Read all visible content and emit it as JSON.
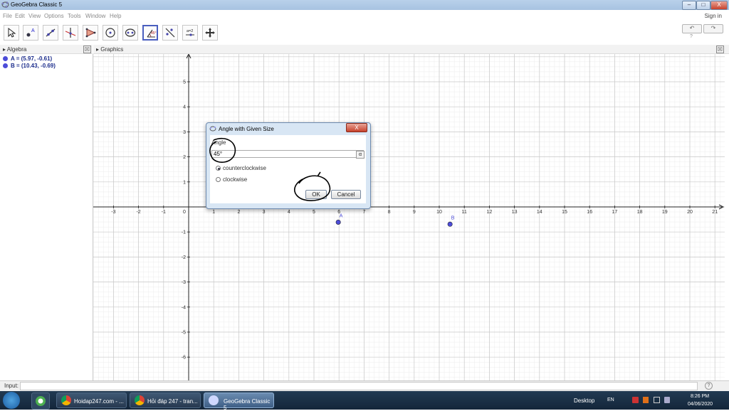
{
  "window": {
    "title": "GeoGebra Classic 5"
  },
  "menu": {
    "items": [
      "File",
      "Edit",
      "View",
      "Options",
      "Tools",
      "Window",
      "Help"
    ],
    "signin": "Sign in"
  },
  "window_buttons": {
    "minimize": "–",
    "maximize": "□",
    "close": "X"
  },
  "toolbar": {
    "undo": "↶",
    "redo": "↷",
    "help": "?"
  },
  "panels": {
    "algebra_title": "Algebra",
    "graphics_title": "Graphics",
    "close_glyph": "☒"
  },
  "algebra": {
    "items": [
      {
        "text": "A = (5.97, -0.61)"
      },
      {
        "text": "B = (10.43, -0.69)"
      }
    ]
  },
  "graphics": {
    "x_ticks": [
      "-3",
      "-2",
      "-1",
      "0",
      "1",
      "2",
      "3",
      "4",
      "5",
      "6",
      "7",
      "8",
      "9",
      "10",
      "11",
      "12",
      "13",
      "14",
      "15",
      "16",
      "17",
      "18",
      "19",
      "20",
      "21"
    ],
    "y_ticks_pos": [
      "1",
      "2",
      "3",
      "4",
      "5"
    ],
    "y_ticks_neg": [
      "-1",
      "-2",
      "-3",
      "-4",
      "-5",
      "-6"
    ],
    "points": [
      {
        "label": "A",
        "x": 5.97,
        "y": -0.61
      },
      {
        "label": "B",
        "x": 10.43,
        "y": -0.69
      }
    ],
    "point_color": "#4c4cd8"
  },
  "dialog": {
    "title": "Angle with Given Size",
    "angle_label": "Angle",
    "angle_value": "45°",
    "alpha_button": "α",
    "options": [
      "counterclockwise",
      "clockwise"
    ],
    "selected_option": "counterclockwise",
    "ok": "OK",
    "cancel": "Cancel",
    "close": "X"
  },
  "input_bar": {
    "label": "Input:",
    "help": "?"
  },
  "taskbar": {
    "tasks": [
      "Hoidap247.com - ...",
      "Hỏi đáp 247 - tran...",
      "GeoGebra Classic 5"
    ],
    "desktop": "Desktop",
    "lang": "EN",
    "time": "8:26 PM",
    "date": "04/06/2020"
  }
}
